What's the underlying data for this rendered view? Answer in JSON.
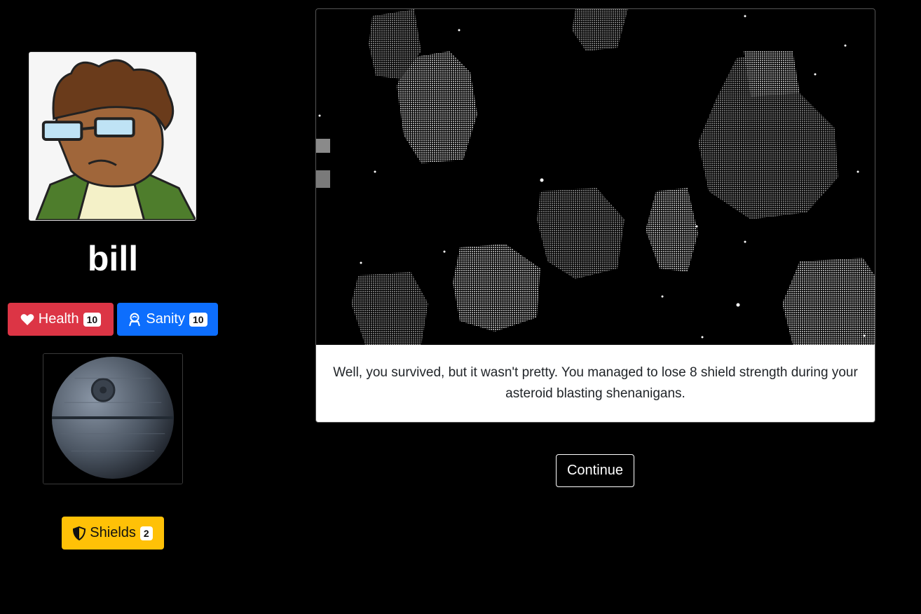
{
  "player": {
    "name": "bill"
  },
  "stats": {
    "health": {
      "label": "Health",
      "value": "10",
      "color": "#dc3545",
      "icon": "heart-icon"
    },
    "sanity": {
      "label": "Sanity",
      "value": "10",
      "color": "#0d6efd",
      "icon": "brain-person-icon"
    },
    "shields": {
      "label": "Shields",
      "value": "2",
      "color": "#ffc107",
      "icon": "shield-icon"
    }
  },
  "event": {
    "message": "Well, you survived, but it wasn't pretty. You managed to lose 8 shield strength during your asteroid blasting shenanigans."
  },
  "actions": {
    "continue_label": "Continue"
  }
}
